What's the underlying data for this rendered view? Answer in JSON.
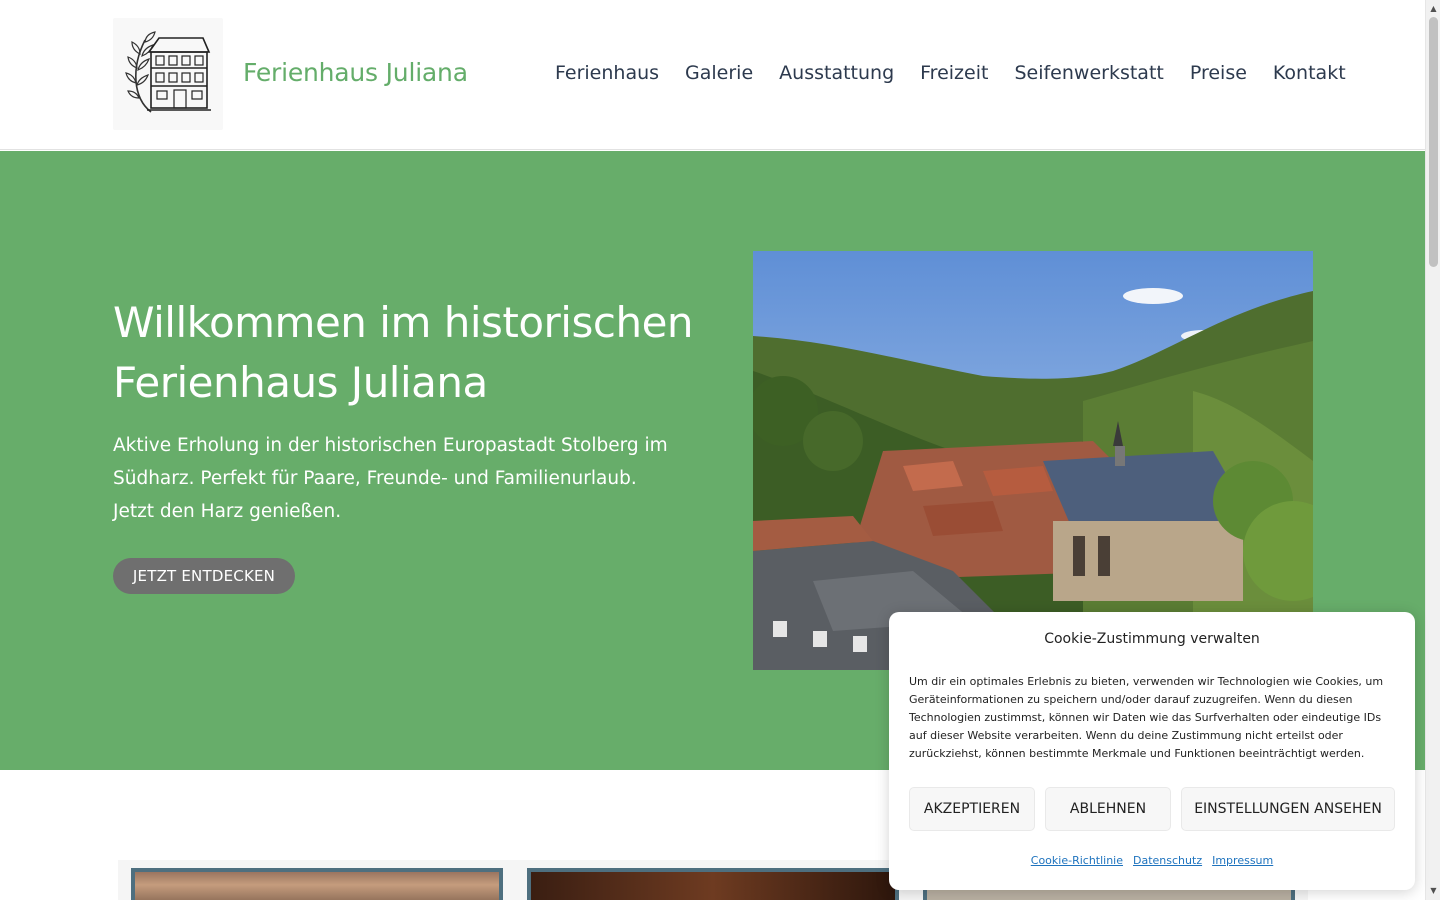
{
  "header": {
    "logo_icon": "half-timbered-house-logo",
    "site_title": "Ferienhaus Juliana",
    "nav": [
      {
        "label": "Ferienhaus"
      },
      {
        "label": "Galerie"
      },
      {
        "label": "Ausstattung"
      },
      {
        "label": "Freizeit"
      },
      {
        "label": "Seifenwerkstatt"
      },
      {
        "label": "Preise"
      },
      {
        "label": "Kontakt"
      }
    ]
  },
  "hero": {
    "title": "Willkommen im historischen Ferienhaus Juliana",
    "text": "Aktive Erholung in der historischen Europastadt Stolberg im Südharz. Perfekt für Paare, Freunde- und Familienurlaub. Jetzt den Harz genießen.",
    "button_label": "JETZT ENTDECKEN",
    "image": "stolberg-town-valley-photo",
    "background_color": "#67ad6a"
  },
  "cookie": {
    "title": "Cookie-Zustimmung verwalten",
    "text": "Um dir ein optimales Erlebnis zu bieten, verwenden wir Technologien wie Cookies, um Geräteinformationen zu speichern und/oder darauf zuzugreifen. Wenn du diesen Technologien zustimmst, können wir Daten wie das Surfverhalten oder eindeutige IDs auf dieser Website verarbeiten. Wenn du deine Zustimmung nicht erteilst oder zurückziehst, können bestimmte Merkmale und Funktionen beeinträchtigt werden.",
    "accept_label": "AKZEPTIEREN",
    "deny_label": "ABLEHNEN",
    "settings_label": "EINSTELLUNGEN ANSEHEN",
    "links": [
      {
        "label": "Cookie-Richtlinie"
      },
      {
        "label": "Datenschutz"
      },
      {
        "label": "Impressum"
      }
    ]
  },
  "colors": {
    "accent_green": "#64ad6a",
    "nav_text": "#2d3a4e",
    "button_gray": "#6f6f6f",
    "link_blue": "#1e73be"
  }
}
